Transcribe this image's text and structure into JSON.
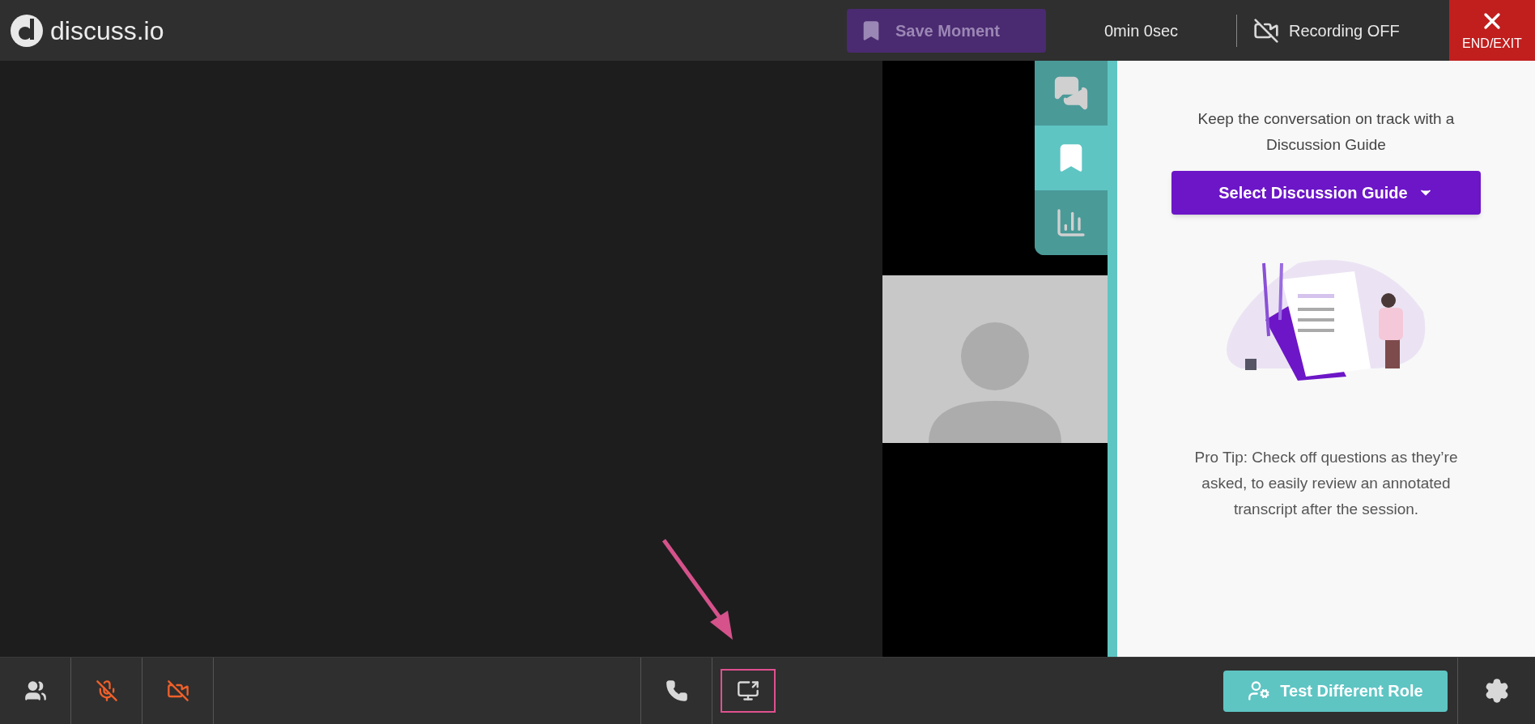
{
  "header": {
    "logo": "discuss.io",
    "save_moment": {
      "label": "Save Moment",
      "disabled": true
    },
    "timer": "0min 0sec",
    "recording": "Recording OFF",
    "end_button": "END/EXIT"
  },
  "side_tabs": [
    {
      "kind": "chat",
      "selected": false
    },
    {
      "kind": "guide",
      "selected": true
    },
    {
      "kind": "stats",
      "selected": false
    }
  ],
  "guide_panel": {
    "heading": "Keep the conversation on track with a Discussion Guide",
    "button": "Select Discussion Guide",
    "tip": "Pro Tip: Check off questions as they’re asked, to easily review an annotated transcript after the session."
  },
  "toolbar": {
    "left": [
      {
        "kind": "participants",
        "muted": false
      },
      {
        "kind": "mic",
        "muted": true
      },
      {
        "kind": "camera",
        "muted": true
      }
    ],
    "center": [
      {
        "kind": "phone",
        "highlighted": false
      },
      {
        "kind": "share",
        "highlighted": true
      }
    ],
    "role_button": "Test Different Role"
  }
}
